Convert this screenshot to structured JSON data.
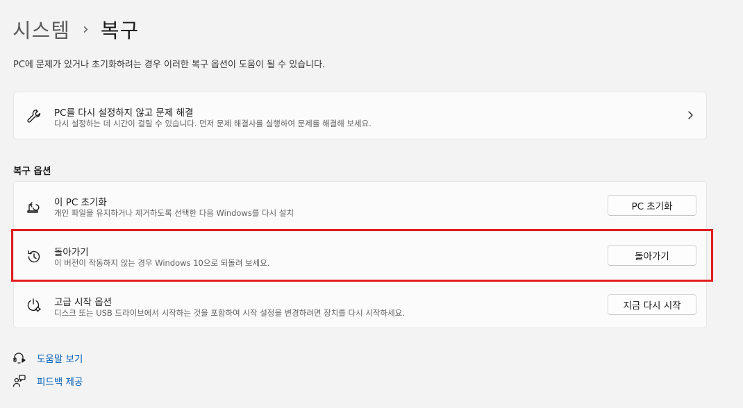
{
  "breadcrumb": {
    "parent": "시스템",
    "separator": "›",
    "current": "복구"
  },
  "page_description": "PC에 문제가 있거나 초기화하려는 경우 이러한 복구 옵션이 도움이 될 수 있습니다.",
  "troubleshoot": {
    "title": "PC를 다시 설정하지 않고 문제 해결",
    "subtitle": "다시 설정하는 데 시간이 걸릴 수 있습니다. 먼저 문제 해결사를 실행하여 문제를 해결해 보세요.",
    "icon": "wrench-icon"
  },
  "recovery_options": {
    "heading": "복구 옵션",
    "items": [
      {
        "title": "이 PC 초기화",
        "subtitle": "개인 파일을 유지하거나 제거하도록 선택한 다음 Windows를 다시 설치",
        "button": "PC 초기화",
        "icon": "reset-pc-icon"
      },
      {
        "title": "돌아가기",
        "subtitle": "이 버전이 작동하지 않는 경우 Windows 10으로 되돌려 보세요.",
        "button": "돌아가기",
        "icon": "history-icon"
      },
      {
        "title": "고급 시작 옵션",
        "subtitle": "디스크 또는 USB 드라이브에서 시작하는 것을 포함하여 시작 설정을 변경하려면 장치를 다시 시작하세요.",
        "button": "지금 다시 시작",
        "icon": "advanced-startup-icon"
      }
    ]
  },
  "footer_links": [
    {
      "label": "도움말 보기",
      "icon": "help-icon"
    },
    {
      "label": "피드백 제공",
      "icon": "feedback-icon"
    }
  ],
  "colors": {
    "background": "#f3f3f3",
    "card": "#fbfbfb",
    "link": "#005fb8",
    "highlight": "#e31d1d"
  }
}
